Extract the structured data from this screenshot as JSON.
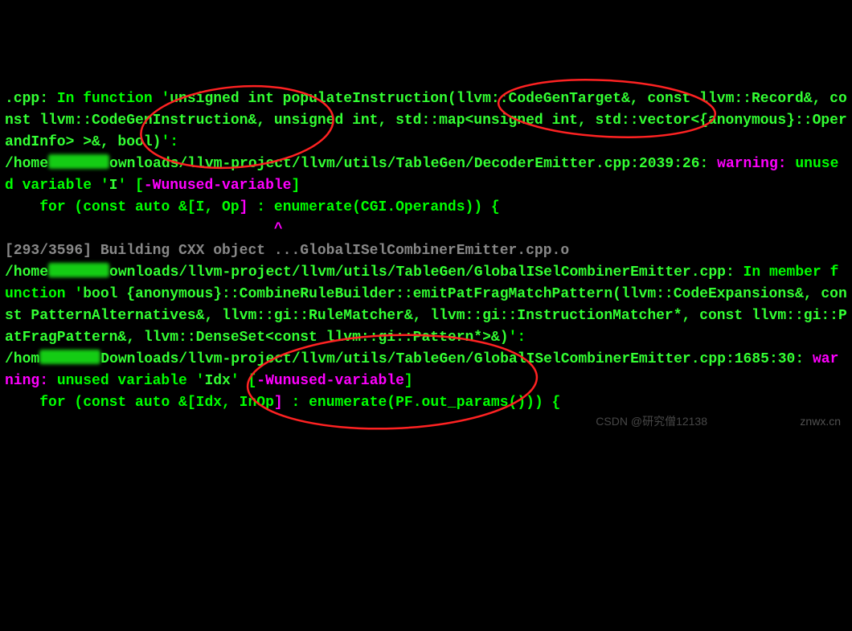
{
  "line1_pre": ".cpp:",
  "line1_text": " In function '",
  "line1_sig": "unsigned int populateInstruction(llvm::CodeGenTarget&, const llvm::Record&, const llvm::CodeGenInstruction&, unsigned int, std::map<unsigned int, std::vector<{anonymous}::OperandInfo> >&, bool)",
  "line1_post": "':",
  "path1a": "/home",
  "path1b": "ownloads/llvm-project/llvm/utils/TableGen/DecoderEmitter.cpp:2039:26: ",
  "warn_label": "warning: ",
  "warn1_msg": "unused variable '",
  "warn1_var": "I",
  "warn1_end": "' [",
  "warn1_flag": "-Wunused-variable",
  "warn1_close": "]",
  "snippet1_pre": "    for (const auto &[I, Op",
  "snippet1_bracket": "]",
  "snippet1_post": " : enumerate(CGI.Operands)) {",
  "caret1_spaces": "                               ",
  "caret1": "^",
  "build_progress": "[293/3596] Building CXX object ...GlobalISelCombinerEmitter.cpp.o",
  "path2a": "/home",
  "path2b": "ownloads/llvm-project/llvm/utils/TableGen/GlobalISelCombinerEmitter.cpp:",
  "line2_text": " In member function '",
  "line2_sig": "bool {anonymous}::CombineRuleBuilder::emitPatFragMatchPattern(llvm::CodeExpansions&, const PatternAlternatives&, llvm::gi::RuleMatcher&, llvm::gi::InstructionMatcher*, const llvm::gi::PatFragPattern&, llvm::DenseSet<const llvm::gi::Pattern*>&)",
  "line2_post": "':",
  "path3a": "/hom",
  "path3b": "Downloads/llvm-project/llvm/utils/TableGen/GlobalISelCombinerEmitter.cpp:1685:30: ",
  "warn2_msg": "unused variable '",
  "warn2_var": "Idx",
  "warn2_end": "' [",
  "warn2_flag": "-Wunused-variable",
  "warn2_close": "]",
  "snippet2_pre": "    for (const auto &[Idx, InOp",
  "snippet2_bracket": "]",
  "snippet2_post": " : enumerate(PF.out_params())) {",
  "wm1": "CSDN @研究僧12138",
  "wm2": "znwx.cn"
}
